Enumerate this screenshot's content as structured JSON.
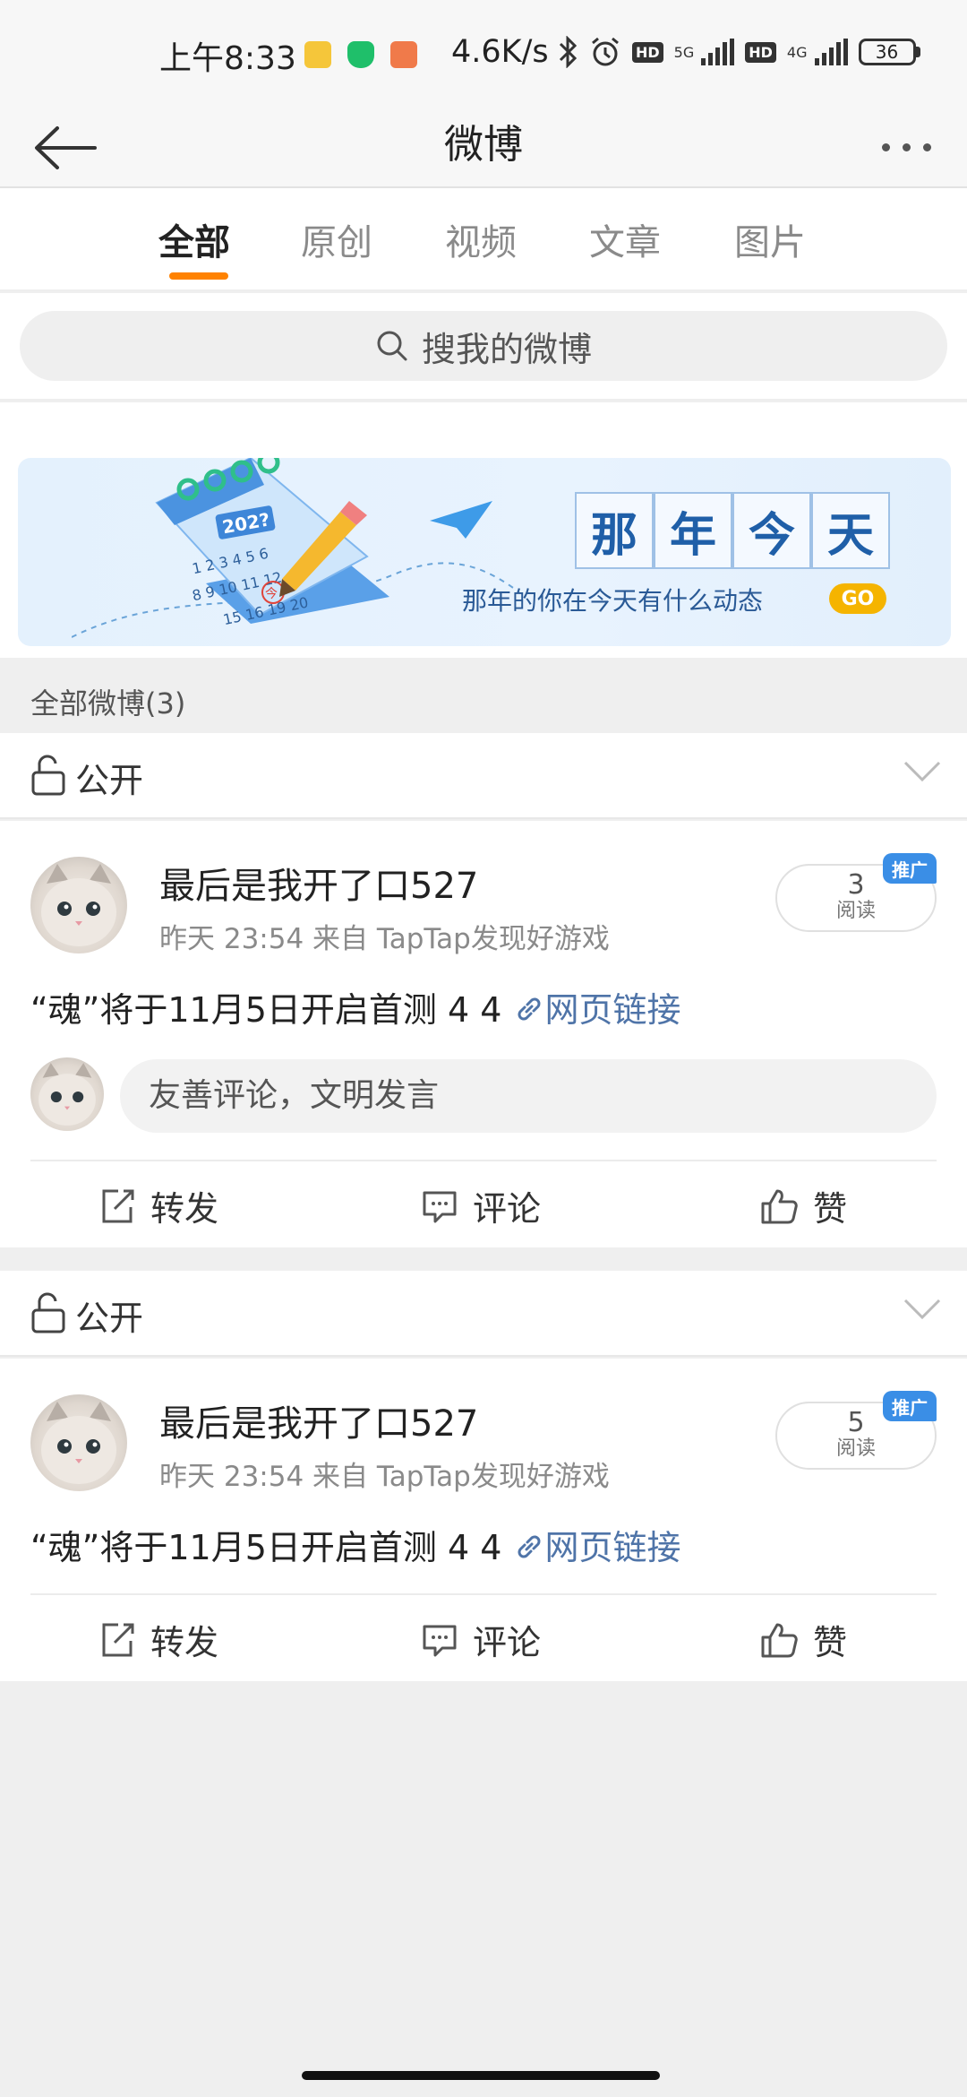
{
  "status_bar": {
    "time": "上午8:33",
    "network_speed": "4.6K/s",
    "net_1": "5G",
    "net_2": "4G",
    "hd_label": "HD",
    "battery": "36"
  },
  "header": {
    "title": "微博"
  },
  "tabs": [
    {
      "label": "全部",
      "active": true
    },
    {
      "label": "原创",
      "active": false
    },
    {
      "label": "视频",
      "active": false
    },
    {
      "label": "文章",
      "active": false
    },
    {
      "label": "图片",
      "active": false
    }
  ],
  "search": {
    "placeholder": "搜我的微博"
  },
  "banner": {
    "title_chars": [
      "那",
      "年",
      "今",
      "天"
    ],
    "subtitle": "那年的你在今天有什么动态",
    "go_label": "GO",
    "calendar_year": "202?",
    "calendar_today": "今"
  },
  "count_label": "全部微博(3)",
  "posts": [
    {
      "visibility": "公开",
      "author": "最后是我开了口527",
      "meta": "昨天 23:54   来自 TapTap发现好游戏",
      "content": "“魂”将于11月5日开启首测 4 4",
      "link_text": "网页链接",
      "reads": "3",
      "reads_unit": "阅读",
      "promo_badge": "推广",
      "comment_placeholder": "友善评论，文明发言",
      "actions": {
        "repost": "转发",
        "comment": "评论",
        "like": "赞"
      }
    },
    {
      "visibility": "公开",
      "author": "最后是我开了口527",
      "meta": "昨天 23:54   来自 TapTap发现好游戏",
      "content": "“魂”将于11月5日开启首测 4 4",
      "link_text": "网页链接",
      "reads": "5",
      "reads_unit": "阅读",
      "promo_badge": "推广",
      "actions": {
        "repost": "转发",
        "comment": "评论",
        "like": "赞"
      }
    }
  ],
  "colors": {
    "accent": "#ff8200",
    "link": "#4f74a8",
    "promo": "#3a8ee6",
    "go": "#f5b400"
  }
}
